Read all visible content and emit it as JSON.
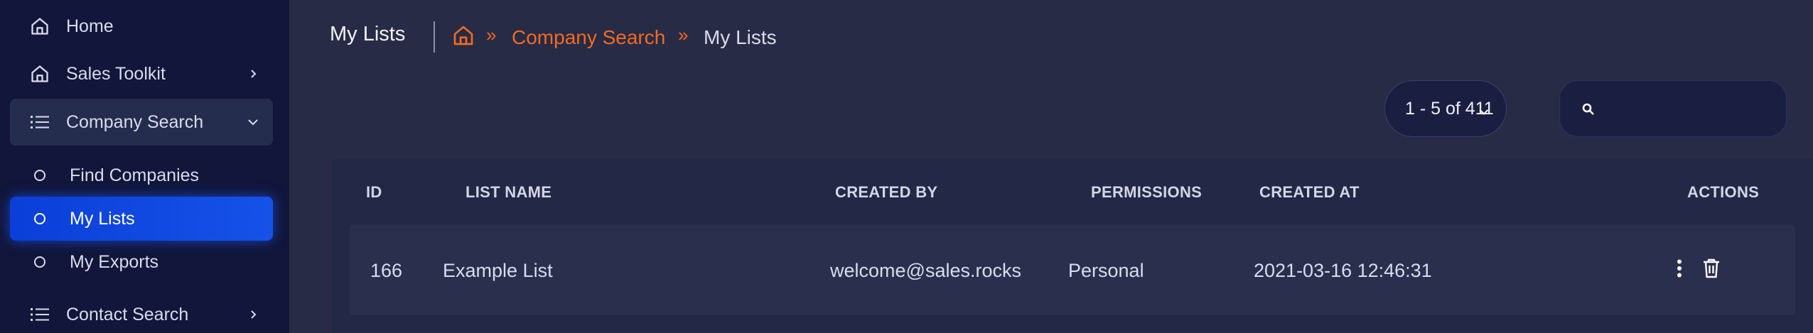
{
  "sidebar": {
    "items": [
      {
        "label": "Home",
        "icon": "home-icon"
      },
      {
        "label": "Sales Toolkit",
        "icon": "home-icon"
      },
      {
        "label": "Company Search",
        "icon": "list-icon"
      },
      {
        "label": "Contact Search",
        "icon": "list-icon"
      }
    ],
    "sub_items": [
      {
        "label": "Find Companies"
      },
      {
        "label": "My Lists"
      },
      {
        "label": "My Exports"
      }
    ]
  },
  "header": {
    "title": "My Lists",
    "breadcrumb": {
      "separator": "»",
      "link": "Company Search",
      "current": "My Lists"
    }
  },
  "pagination": {
    "label": "1 - 5 of 411"
  },
  "search": {
    "value": "",
    "placeholder": ""
  },
  "table": {
    "columns": [
      "ID",
      "LIST NAME",
      "CREATED BY",
      "PERMISSIONS",
      "CREATED AT",
      "ACTIONS"
    ],
    "rows": [
      {
        "id": "166",
        "name": "Example List",
        "created_by": "welcome@sales.rocks",
        "permissions": "Personal",
        "created_at": "2021-03-16 12:46:31"
      }
    ]
  },
  "colors": {
    "accent": "#f26a21",
    "active": "#0a3fd8",
    "sidebar_bg": "#11163a",
    "main_bg": "#272b45"
  }
}
